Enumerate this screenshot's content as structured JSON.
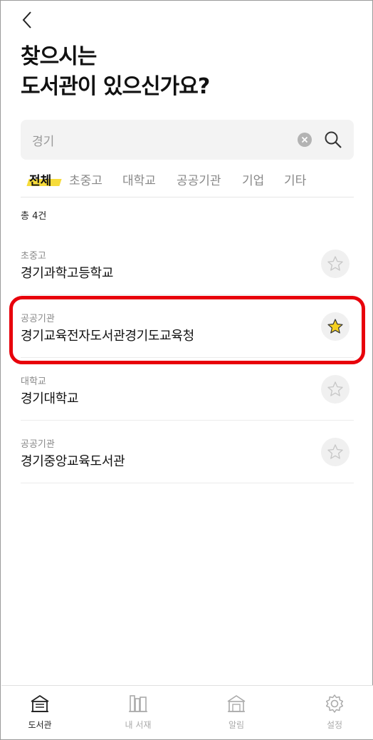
{
  "header": {
    "title_line1": "찾으시는",
    "title_line2": "도서관이 있으신가요?"
  },
  "search": {
    "value": "경기",
    "icon": "search-icon",
    "clear_icon": "clear-icon"
  },
  "tabs": [
    {
      "label": "전체",
      "active": true
    },
    {
      "label": "초중고",
      "active": false
    },
    {
      "label": "대학교",
      "active": false
    },
    {
      "label": "공공기관",
      "active": false
    },
    {
      "label": "기업",
      "active": false
    },
    {
      "label": "기타",
      "active": false
    }
  ],
  "result_count": "총 4건",
  "results": [
    {
      "category": "초중고",
      "name": "경기과학고등학교",
      "favorited": false
    },
    {
      "category": "공공기관",
      "name": "경기교육전자도서관경기도교육청",
      "favorited": true
    },
    {
      "category": "대학교",
      "name": "경기대학교",
      "favorited": false
    },
    {
      "category": "공공기관",
      "name": "경기중앙교육도서관",
      "favorited": false
    }
  ],
  "bottom_nav": [
    {
      "label": "도서관",
      "icon": "library-icon",
      "active": true
    },
    {
      "label": "내 서재",
      "icon": "bookshelf-icon",
      "active": false
    },
    {
      "label": "알림",
      "icon": "notification-icon",
      "active": false
    },
    {
      "label": "설정",
      "icon": "settings-icon",
      "active": false
    }
  ],
  "colors": {
    "accent": "#f7dc3a",
    "star_filled": "#f5d021",
    "highlight_border": "#e8000b"
  }
}
